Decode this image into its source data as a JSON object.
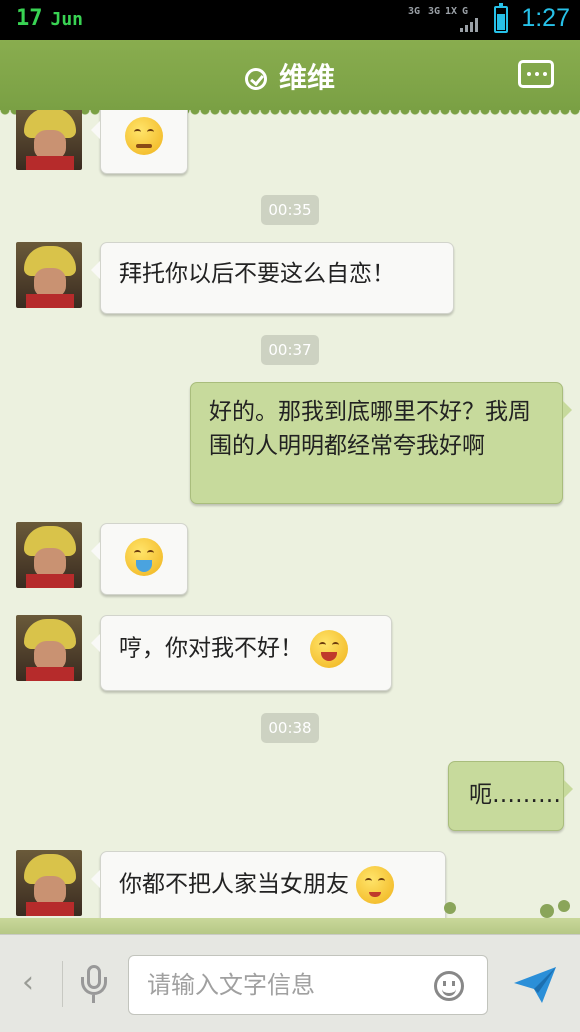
{
  "status_bar": {
    "day": "17",
    "month": "Jun",
    "network_labels": [
      "3G",
      "3G",
      "1X",
      "G"
    ],
    "time": "1:27",
    "accent_color": "#27c1e8",
    "battery_level": 0.7
  },
  "header": {
    "title": "维维",
    "status_icon": "check-circle-icon",
    "menu_icon": "more-icon"
  },
  "messages": [
    {
      "side": "in",
      "type": "emoji",
      "emoji": "sweating-face"
    },
    {
      "type": "time",
      "text": "00:35"
    },
    {
      "side": "in",
      "type": "text",
      "text": "拜托你以后不要这么自恋！"
    },
    {
      "type": "time",
      "text": "00:37"
    },
    {
      "side": "out",
      "type": "text",
      "text": "好的。那我到底哪里不好？我周围的人明明都经常夸我好啊"
    },
    {
      "side": "in",
      "type": "emoji",
      "emoji": "vomit-face"
    },
    {
      "side": "in",
      "type": "text",
      "text": "哼，你对我不好！",
      "emoji": "laughing-face"
    },
    {
      "type": "time",
      "text": "00:38"
    },
    {
      "side": "out",
      "type": "text",
      "text": "呃………"
    },
    {
      "side": "in",
      "type": "text",
      "text": "你都不把人家当女朋友",
      "emoji": "embarrassed-face"
    }
  ],
  "input_bar": {
    "placeholder": "请输入文字信息",
    "back_icon": "chevron-left-icon",
    "voice_icon": "microphone-icon",
    "emoji_icon": "smiley-icon",
    "send_icon": "paper-plane-icon"
  },
  "colors": {
    "header": "#7aa044",
    "chat_bg": "#ecf1df",
    "outgoing_bubble": "#c7da9c",
    "incoming_bubble": "#f9f9f7"
  }
}
